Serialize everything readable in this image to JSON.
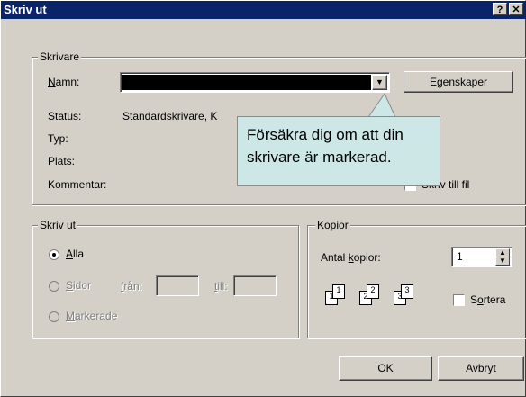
{
  "window": {
    "title": "Skriv ut"
  },
  "printer_group": {
    "legend": "Skrivare",
    "name_label": "Namn:",
    "properties_button": "Egenskaper",
    "status_label": "Status:",
    "status_value": "Standardskrivare, K",
    "type_label": "Typ:",
    "location_label": "Plats:",
    "comment_label": "Kommentar:",
    "print_to_file_label": "Skriv till fil"
  },
  "tooltip": {
    "text": "Försäkra dig om att din skrivare är markerad."
  },
  "print_range_group": {
    "legend": "Skriv ut",
    "all_label": "Alla",
    "pages_label": "Sidor",
    "from_label": "från:",
    "to_label": "till:",
    "selection_label": "Markerade"
  },
  "copies_group": {
    "legend": "Kopior",
    "copies_label": "Antal kopior:",
    "copies_value": "1",
    "collate_label": "Sortera"
  },
  "buttons": {
    "ok": "OK",
    "cancel": "Avbryt"
  }
}
